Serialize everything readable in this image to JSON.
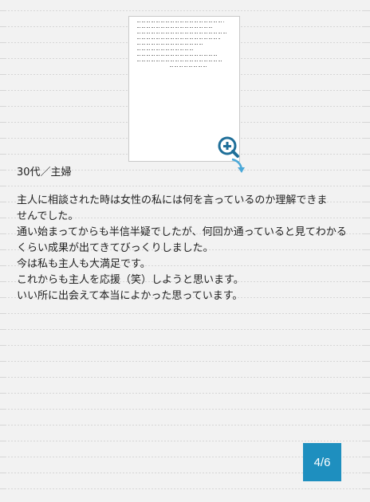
{
  "profile": {
    "label": "30代／主婦"
  },
  "testimonial": {
    "lines": [
      "主人に相談された時は女性の私には何を言っているのか理解できま",
      "せんでした。",
      "通い始まってからも半信半疑でしたが、何回か通っていると見てわかる",
      "くらい成果が出てきてびっくりしました。",
      "今は私も主人も大満足です。",
      "これからも主人を応援（笑）しようと思います。",
      "いい所に出会えて本当によかった思っています。"
    ]
  },
  "letter_image": {
    "kind": "handwritten-letter-thumbnail"
  },
  "zoom": {
    "icon": "zoom-in-icon",
    "color": "#1f8fbf"
  },
  "pager": {
    "label": "4/6",
    "color": "#1e8fbf"
  }
}
